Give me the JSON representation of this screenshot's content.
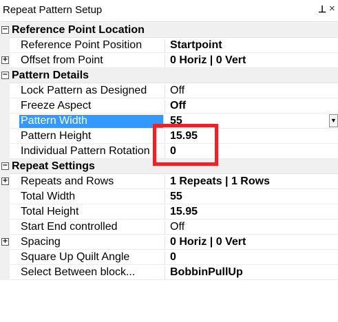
{
  "window": {
    "title": "Repeat Pattern Setup",
    "pin_icon": "pin-icon",
    "close_glyph": "×"
  },
  "categories": {
    "reference": {
      "label": "Reference Point Location",
      "reference_point_position": {
        "name": "Reference Point Position",
        "value": "Startpoint"
      },
      "offset_from_point": {
        "name": "Offset from Point",
        "value": "0 Horiz | 0 Vert"
      }
    },
    "pattern": {
      "label": "Pattern Details",
      "lock_pattern": {
        "name": "Lock Pattern as Designed",
        "value": "Off"
      },
      "freeze_aspect": {
        "name": "Freeze Aspect",
        "value": "Off"
      },
      "pattern_width": {
        "name": "Pattern Width",
        "value": "55"
      },
      "pattern_height": {
        "name": "Pattern Height",
        "value": "15.95"
      },
      "individual_rotation": {
        "name": "Individual Pattern Rotation",
        "value": "0"
      }
    },
    "repeat": {
      "label": "Repeat Settings",
      "repeats_rows": {
        "name": "Repeats and Rows",
        "value": "1 Repeats | 1 Rows"
      },
      "total_width": {
        "name": "Total Width",
        "value": "55"
      },
      "total_height": {
        "name": "Total Height",
        "value": "15.95"
      },
      "start_end": {
        "name": "Start End controlled",
        "value": "Off"
      },
      "spacing": {
        "name": "Spacing",
        "value": "0 Horiz | 0 Vert"
      },
      "square_up": {
        "name": "Square Up Quilt Angle",
        "value": "0"
      },
      "select_between": {
        "name": "Select Between block...",
        "value": "BobbinPullUp"
      }
    }
  },
  "symbols": {
    "collapse": "−",
    "expand": "+",
    "dropdown": "▼"
  },
  "colors": {
    "selection": "#3399ff",
    "highlight": "#e8232a"
  }
}
